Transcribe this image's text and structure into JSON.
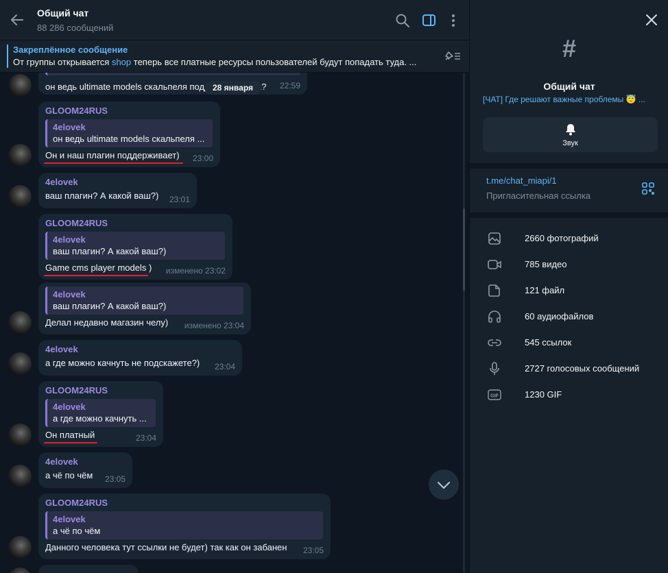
{
  "header": {
    "title": "Общий чат",
    "subtitle": "88 286 сообщений"
  },
  "pinned": {
    "title": "Закреплённое сообщение",
    "text_before": "От группы открывается ",
    "link": "shop",
    "text_after": " теперь все платные ресурсы пользователей будут попадать туда. ..."
  },
  "date_pill": "28 января",
  "messages": [
    {
      "text": "он ведь ultimate models скальпеля поддерживает да?",
      "time": "22:59"
    },
    {
      "name": "GLOOM24RUS",
      "reply_name": "4elovek",
      "reply_text": "он ведь ultimate models скальпеля ...",
      "text": "Он и наш плагин поддерживает)",
      "time": "23:00"
    },
    {
      "name": "4elovek",
      "text": "ваш плагин? А какой ваш?)",
      "time": "23:01"
    },
    {
      "name": "GLOOM24RUS",
      "reply_name": "4elovek",
      "reply_text": "ваш плагин? А какой ваш?)",
      "text": "Game cms player models )",
      "time": "изменено 23:02"
    },
    {
      "reply_name": "4elovek",
      "reply_text": "ваш плагин? А какой ваш?)",
      "text": "Делал недавно магазин челу)",
      "time": "изменено 23:04"
    },
    {
      "name": "4elovek",
      "text": "а где можно качнуть не подскажете?)",
      "time": "23:04"
    },
    {
      "name": "GLOOM24RUS",
      "reply_name": "4elovek",
      "reply_text": "а где можно качнуть ...",
      "text": "Он платный",
      "time": "23:04"
    },
    {
      "name": "4elovek",
      "text": "а чё по чём",
      "time": "23:05"
    },
    {
      "name": "GLOOM24RUS",
      "reply_name": "4elovek",
      "reply_text": "а чё по чём",
      "text": "Данного человека тут ссылки не будет) так как он забанен",
      "time": "23:05"
    }
  ],
  "side": {
    "hash": "#",
    "name": "Общий чат",
    "description": "[ЧАТ] Где решают важные проблемы 😇 ...",
    "sound_label": "Звук",
    "invite_link": "t.me/chat_miapi/1",
    "invite_label": "Пригласительная ссылка",
    "media": [
      {
        "icon": "photo-icon",
        "label": "2660 фотографий"
      },
      {
        "icon": "video-icon",
        "label": "785 видео"
      },
      {
        "icon": "file-icon",
        "label": "121 файл"
      },
      {
        "icon": "headphones-icon",
        "label": "60 аудиофайлов"
      },
      {
        "icon": "link-icon",
        "label": "545 ссылок"
      },
      {
        "icon": "microphone-icon",
        "label": "2727 голосовых сообщений"
      },
      {
        "icon": "gif-icon",
        "label": "1230 GIF"
      }
    ]
  },
  "colors": {
    "accent": "#5eb5f7",
    "bubble": "#182533",
    "reply_name": "#9c8ae0",
    "underline": "#e5202a",
    "background": "#0e1621",
    "panel": "#17212b"
  }
}
